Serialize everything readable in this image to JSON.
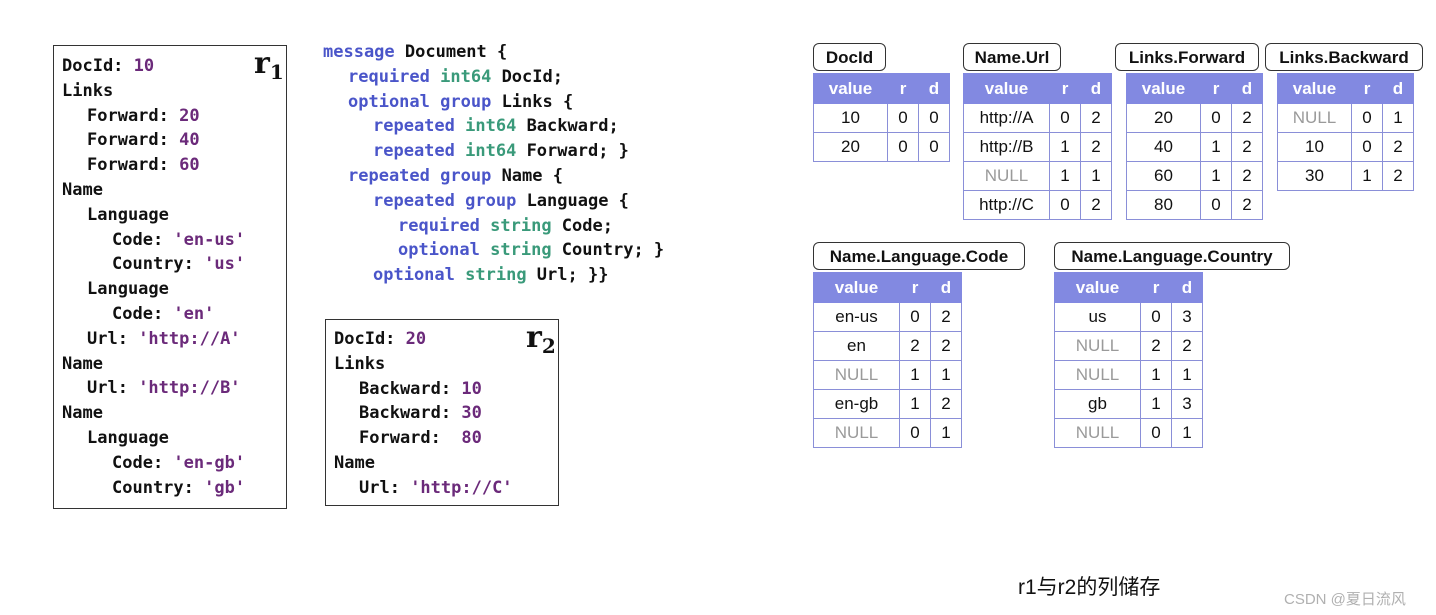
{
  "record1": {
    "label": "r",
    "sub": "1",
    "lines": [
      {
        "indent": 0,
        "parts": [
          {
            "t": "DocId: ",
            "c": "plain"
          },
          {
            "t": "10",
            "c": "num"
          }
        ]
      },
      {
        "indent": 0,
        "parts": [
          {
            "t": "Links",
            "c": "plain"
          }
        ]
      },
      {
        "indent": 1,
        "parts": [
          {
            "t": "Forward: ",
            "c": "plain"
          },
          {
            "t": "20",
            "c": "num"
          }
        ]
      },
      {
        "indent": 1,
        "parts": [
          {
            "t": "Forward: ",
            "c": "plain"
          },
          {
            "t": "40",
            "c": "num"
          }
        ]
      },
      {
        "indent": 1,
        "parts": [
          {
            "t": "Forward: ",
            "c": "plain"
          },
          {
            "t": "60",
            "c": "num"
          }
        ]
      },
      {
        "indent": 0,
        "parts": [
          {
            "t": "Name",
            "c": "plain"
          }
        ]
      },
      {
        "indent": 1,
        "parts": [
          {
            "t": "Language",
            "c": "plain"
          }
        ]
      },
      {
        "indent": 2,
        "parts": [
          {
            "t": "Code: ",
            "c": "plain"
          },
          {
            "t": "'en-us'",
            "c": "str"
          }
        ]
      },
      {
        "indent": 2,
        "parts": [
          {
            "t": "Country: ",
            "c": "plain"
          },
          {
            "t": "'us'",
            "c": "str"
          }
        ]
      },
      {
        "indent": 1,
        "parts": [
          {
            "t": "Language",
            "c": "plain"
          }
        ]
      },
      {
        "indent": 2,
        "parts": [
          {
            "t": "Code: ",
            "c": "plain"
          },
          {
            "t": "'en'",
            "c": "str"
          }
        ]
      },
      {
        "indent": 1,
        "parts": [
          {
            "t": "Url: ",
            "c": "plain"
          },
          {
            "t": "'http://A'",
            "c": "str"
          }
        ]
      },
      {
        "indent": 0,
        "parts": [
          {
            "t": "Name",
            "c": "plain"
          }
        ]
      },
      {
        "indent": 1,
        "parts": [
          {
            "t": "Url: ",
            "c": "plain"
          },
          {
            "t": "'http://B'",
            "c": "str"
          }
        ]
      },
      {
        "indent": 0,
        "parts": [
          {
            "t": "Name",
            "c": "plain"
          }
        ]
      },
      {
        "indent": 1,
        "parts": [
          {
            "t": "Language",
            "c": "plain"
          }
        ]
      },
      {
        "indent": 2,
        "parts": [
          {
            "t": "Code: ",
            "c": "plain"
          },
          {
            "t": "'en-gb'",
            "c": "str"
          }
        ]
      },
      {
        "indent": 2,
        "parts": [
          {
            "t": "Country: ",
            "c": "plain"
          },
          {
            "t": "'gb'",
            "c": "str"
          }
        ]
      }
    ]
  },
  "record2": {
    "label": "r",
    "sub": "2",
    "lines": [
      {
        "indent": 0,
        "parts": [
          {
            "t": "DocId: ",
            "c": "plain"
          },
          {
            "t": "20",
            "c": "num"
          }
        ]
      },
      {
        "indent": 0,
        "parts": [
          {
            "t": "Links",
            "c": "plain"
          }
        ]
      },
      {
        "indent": 1,
        "parts": [
          {
            "t": "Backward: ",
            "c": "plain"
          },
          {
            "t": "10",
            "c": "num"
          }
        ]
      },
      {
        "indent": 1,
        "parts": [
          {
            "t": "Backward: ",
            "c": "plain"
          },
          {
            "t": "30",
            "c": "num"
          }
        ]
      },
      {
        "indent": 1,
        "parts": [
          {
            "t": "Forward:  ",
            "c": "plain"
          },
          {
            "t": "80",
            "c": "num"
          }
        ]
      },
      {
        "indent": 0,
        "parts": [
          {
            "t": "Name",
            "c": "plain"
          }
        ]
      },
      {
        "indent": 1,
        "parts": [
          {
            "t": "Url: ",
            "c": "plain"
          },
          {
            "t": "'http://C'",
            "c": "str"
          }
        ]
      }
    ]
  },
  "schema": [
    {
      "indent": 0,
      "parts": [
        {
          "t": "message",
          "c": "kw"
        },
        {
          "t": " Document {",
          "c": "plain"
        }
      ]
    },
    {
      "indent": 1,
      "parts": [
        {
          "t": "required",
          "c": "kw"
        },
        {
          "t": " ",
          "c": "plain"
        },
        {
          "t": "int64",
          "c": "ty"
        },
        {
          "t": " DocId;",
          "c": "plain"
        }
      ]
    },
    {
      "indent": 1,
      "parts": [
        {
          "t": "optional",
          "c": "kw"
        },
        {
          "t": " ",
          "c": "plain"
        },
        {
          "t": "group",
          "c": "kw"
        },
        {
          "t": " Links {",
          "c": "plain"
        }
      ]
    },
    {
      "indent": 2,
      "parts": [
        {
          "t": "repeated",
          "c": "kw"
        },
        {
          "t": " ",
          "c": "plain"
        },
        {
          "t": "int64",
          "c": "ty"
        },
        {
          "t": " Backward;",
          "c": "plain"
        }
      ]
    },
    {
      "indent": 2,
      "parts": [
        {
          "t": "repeated",
          "c": "kw"
        },
        {
          "t": " ",
          "c": "plain"
        },
        {
          "t": "int64",
          "c": "ty"
        },
        {
          "t": " Forward; }",
          "c": "plain"
        }
      ]
    },
    {
      "indent": 1,
      "parts": [
        {
          "t": "repeated",
          "c": "kw"
        },
        {
          "t": " ",
          "c": "plain"
        },
        {
          "t": "group",
          "c": "kw"
        },
        {
          "t": " Name {",
          "c": "plain"
        }
      ]
    },
    {
      "indent": 2,
      "parts": [
        {
          "t": "repeated",
          "c": "kw"
        },
        {
          "t": " ",
          "c": "plain"
        },
        {
          "t": "group",
          "c": "kw"
        },
        {
          "t": " Language {",
          "c": "plain"
        }
      ]
    },
    {
      "indent": 3,
      "parts": [
        {
          "t": "required",
          "c": "kw"
        },
        {
          "t": " ",
          "c": "plain"
        },
        {
          "t": "string",
          "c": "ty"
        },
        {
          "t": " Code;",
          "c": "plain"
        }
      ]
    },
    {
      "indent": 3,
      "parts": [
        {
          "t": "optional",
          "c": "kw"
        },
        {
          "t": " ",
          "c": "plain"
        },
        {
          "t": "string",
          "c": "ty"
        },
        {
          "t": " Country; }",
          "c": "plain"
        }
      ]
    },
    {
      "indent": 2,
      "parts": [
        {
          "t": "optional",
          "c": "kw"
        },
        {
          "t": " ",
          "c": "plain"
        },
        {
          "t": "string",
          "c": "ty"
        },
        {
          "t": " Url; }}",
          "c": "plain"
        }
      ]
    }
  ],
  "columns": {
    "headers": [
      "value",
      "r",
      "d"
    ],
    "docid": {
      "title": "DocId",
      "rows": [
        [
          "10",
          "0",
          "0"
        ],
        [
          "20",
          "0",
          "0"
        ]
      ]
    },
    "name_url": {
      "title": "Name.Url",
      "rows": [
        [
          "http://A",
          "0",
          "2"
        ],
        [
          "http://B",
          "1",
          "2"
        ],
        [
          "NULL",
          "1",
          "1"
        ],
        [
          "http://C",
          "0",
          "2"
        ]
      ]
    },
    "links_forward": {
      "title": "Links.Forward",
      "rows": [
        [
          "20",
          "0",
          "2"
        ],
        [
          "40",
          "1",
          "2"
        ],
        [
          "60",
          "1",
          "2"
        ],
        [
          "80",
          "0",
          "2"
        ]
      ]
    },
    "links_backward": {
      "title": "Links.Backward",
      "rows": [
        [
          "NULL",
          "0",
          "1"
        ],
        [
          "10",
          "0",
          "2"
        ],
        [
          "30",
          "1",
          "2"
        ]
      ]
    },
    "lang_code": {
      "title": "Name.Language.Code",
      "rows": [
        [
          "en-us",
          "0",
          "2"
        ],
        [
          "en",
          "2",
          "2"
        ],
        [
          "NULL",
          "1",
          "1"
        ],
        [
          "en-gb",
          "1",
          "2"
        ],
        [
          "NULL",
          "0",
          "1"
        ]
      ]
    },
    "lang_country": {
      "title": "Name.Language.Country",
      "rows": [
        [
          "us",
          "0",
          "3"
        ],
        [
          "NULL",
          "2",
          "2"
        ],
        [
          "NULL",
          "1",
          "1"
        ],
        [
          "gb",
          "1",
          "3"
        ],
        [
          "NULL",
          "0",
          "1"
        ]
      ]
    }
  },
  "caption": "r1与r2的列储存",
  "watermark": "CSDN @夏日流风"
}
